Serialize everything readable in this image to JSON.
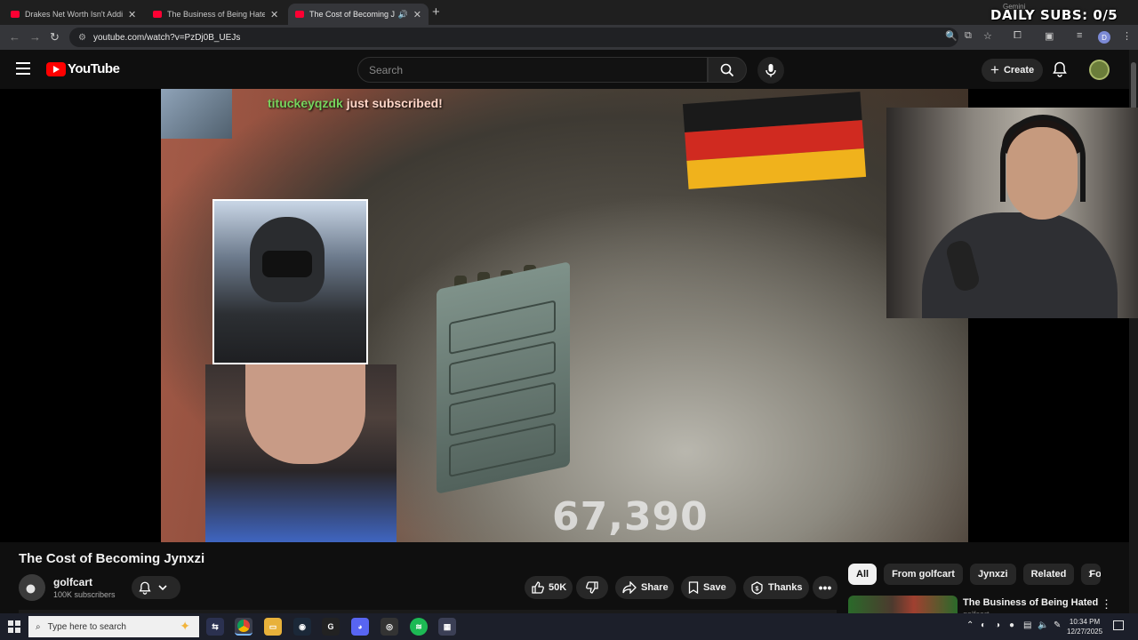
{
  "browser": {
    "tabs": [
      {
        "title": "Drakes Net Worth Isn't Adding Up",
        "active": false
      },
      {
        "title": "The Business of Being Hated - YouTube",
        "active": false
      },
      {
        "title": "The Cost of Becoming Jynxzi",
        "active": true
      }
    ],
    "url": "youtube.com/watch?v=PzDj0B_UEJs",
    "profile_initial": "D"
  },
  "stream_overlay": {
    "daily_subs": "DAILY SUBS: 0/5",
    "gemini_label": "Gemini",
    "sub_notice_name": "tituckeyqzdk",
    "sub_notice_text": "just subscribed!",
    "big_number": "67,390"
  },
  "youtube": {
    "logo_text": "YouTube",
    "search_placeholder": "Search",
    "create_label": "Create"
  },
  "video": {
    "title": "The Cost of Becoming Jynxzi",
    "channel_name": "golfcart",
    "subscribers": "100K subscribers",
    "likes": "50K",
    "share_label": "Share",
    "save_label": "Save",
    "thanks_label": "Thanks"
  },
  "chips": [
    "All",
    "From golfcart",
    "Jynxzi",
    "Related",
    "For you"
  ],
  "recommendation": {
    "title": "The Business of Being Hated",
    "channel": "golfcart"
  },
  "taskbar": {
    "search_placeholder": "Type here to search",
    "time": "10:34 PM",
    "date": "12/27/2025"
  },
  "colors": {
    "accent_red": "#ff0000",
    "background": "#0f0f0f",
    "chip_bg": "#272727"
  }
}
